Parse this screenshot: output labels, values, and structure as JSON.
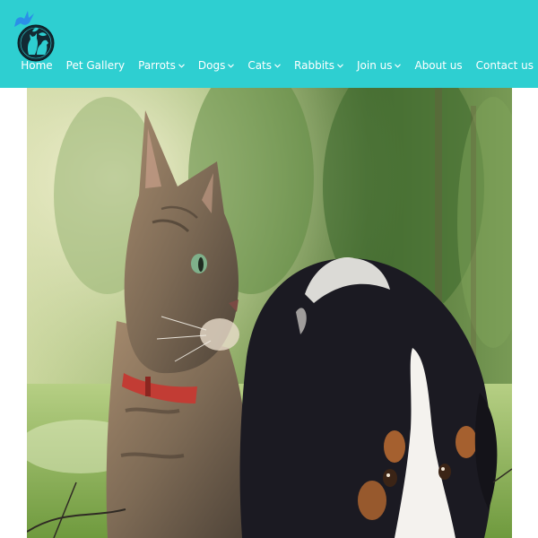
{
  "logo": {
    "icon": "bird-cat-dog-logo-icon"
  },
  "nav": {
    "items": [
      {
        "label": "Home",
        "has_dropdown": false
      },
      {
        "label": "Pet Gallery",
        "has_dropdown": false
      },
      {
        "label": "Parrots",
        "has_dropdown": true
      },
      {
        "label": "Dogs",
        "has_dropdown": true
      },
      {
        "label": "Cats",
        "has_dropdown": true
      },
      {
        "label": "Rabbits",
        "has_dropdown": true
      },
      {
        "label": "Join us",
        "has_dropdown": true
      },
      {
        "label": "About us",
        "has_dropdown": false
      },
      {
        "label": "Contact us",
        "has_dropdown": false
      }
    ]
  },
  "hero": {
    "image": "cat-and-puppy-photo"
  },
  "colors": {
    "header_bg": "#2ecfd1",
    "nav_text": "#ffffff",
    "logo_bird": "#2b8fe8",
    "logo_circle": "#122a33"
  }
}
